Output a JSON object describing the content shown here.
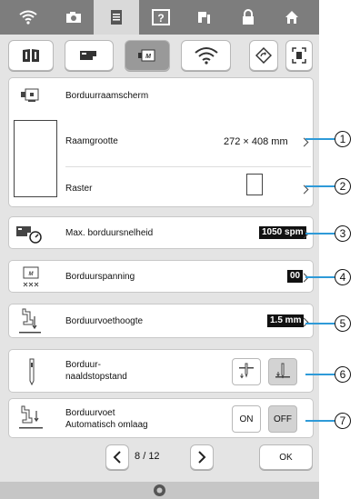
{
  "top_tabs": [
    "wifi-icon",
    "camera-icon",
    "document-icon",
    "help-icon",
    "threading-icon",
    "lock-icon",
    "home-icon"
  ],
  "screen_buttons": [
    "book-icon",
    "sewing-machine-icon",
    "embroidery-frame-icon",
    "wireless-icon",
    "rotate-icon",
    "fit-icon"
  ],
  "settings": {
    "frame_screen": {
      "label": "Borduurraamscherm"
    },
    "frame_size": {
      "label": "Raamgrootte",
      "value": "272 × 408 mm"
    },
    "grid": {
      "label": "Raster"
    },
    "max_speed": {
      "label": "Max. borduursnelheid",
      "value": "1050 spm"
    },
    "tension": {
      "label": "Borduurspanning",
      "value": "00"
    },
    "foot_height": {
      "label": "Borduurvoethoogte",
      "value": "1.5 mm"
    },
    "needle_stop": {
      "label": "Borduur-\nnaaldstopstand"
    },
    "foot_auto": {
      "label": "Borduurvoet\nAutomatisch omlaag",
      "on": "ON",
      "off": "OFF"
    }
  },
  "pager": {
    "current": "8",
    "separator": "/",
    "total": "12",
    "ok": "OK"
  },
  "callouts": [
    "1",
    "2",
    "3",
    "4",
    "5",
    "6",
    "7"
  ]
}
